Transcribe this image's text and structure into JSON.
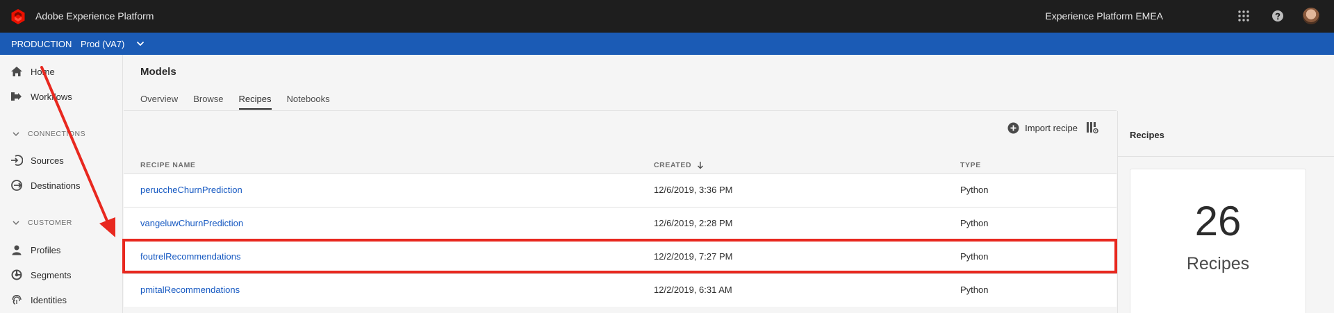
{
  "topbar": {
    "app_title": "Adobe Experience Platform",
    "org_name": "Experience Platform EMEA",
    "brand_color": "#eb1000"
  },
  "sandbox": {
    "type": "PRODUCTION",
    "name": "Prod (VA7)",
    "bar_color": "#1b5bb5"
  },
  "nav": {
    "home": "Home",
    "workflows": "Workflows",
    "connections_section": "CONNECTIONS",
    "sources": "Sources",
    "destinations": "Destinations",
    "customer_section": "CUSTOMER",
    "profiles": "Profiles",
    "segments": "Segments",
    "identities": "Identities"
  },
  "main": {
    "title": "Models",
    "tabs": [
      {
        "label": "Overview",
        "active": false
      },
      {
        "label": "Browse",
        "active": false
      },
      {
        "label": "Recipes",
        "active": true
      },
      {
        "label": "Notebooks",
        "active": false
      }
    ],
    "import_label": "Import recipe",
    "columns": {
      "name": "RECIPE NAME",
      "created": "CREATED",
      "type": "TYPE"
    },
    "rows": [
      {
        "name": "peruccheChurnPrediction",
        "created": "12/6/2019, 3:36 PM",
        "type": "Python"
      },
      {
        "name": "vangeluwChurnPrediction",
        "created": "12/6/2019, 2:28 PM",
        "type": "Python"
      },
      {
        "name": "foutrelRecommendations",
        "created": "12/2/2019, 7:27 PM",
        "type": "Python",
        "highlighted": true
      },
      {
        "name": "pmitalRecommendations",
        "created": "12/2/2019, 6:31 AM",
        "type": "Python"
      }
    ]
  },
  "rail": {
    "title": "Recipes",
    "count": "26",
    "count_label": "Recipes"
  },
  "annotation": {
    "color": "#e8281f"
  }
}
